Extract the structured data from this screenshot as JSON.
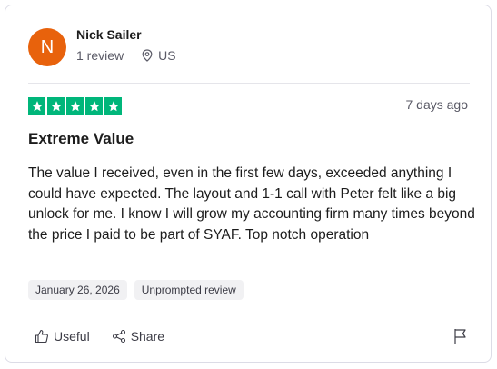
{
  "reviewer": {
    "initial": "N",
    "name": "Nick Sailer",
    "review_count": "1 review",
    "country": "US",
    "avatar_color": "#e8620c"
  },
  "review": {
    "rating": 5,
    "rating_color": "#00b67a",
    "relative_date": "7 days ago",
    "title": "Extreme Value",
    "body": "The value I received, even in the first few days, exceeded anything I could have expected. The layout and 1-1 call with Peter felt like a big unlock for me. I know I will grow my accounting firm many times beyond the price I paid to be part of SYAF. Top notch operation",
    "date": "January 26, 2026",
    "tag": "Unprompted review"
  },
  "actions": {
    "useful_label": "Useful",
    "share_label": "Share",
    "useful_icon": "thumbs-up-icon",
    "share_icon": "share-icon",
    "flag_icon": "flag-icon"
  }
}
